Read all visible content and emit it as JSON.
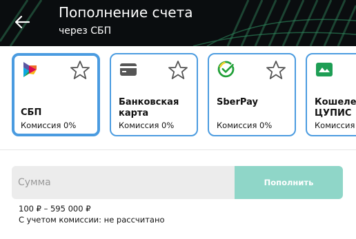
{
  "header": {
    "title": "Пополнение счета",
    "subtitle": "через СБП",
    "background_color": "#0a0d0f",
    "accent_color": "#2f8f62"
  },
  "methods": [
    {
      "name": "СБП",
      "fee": "Комиссия 0%",
      "icon": "sbp-logo-icon",
      "selected": true
    },
    {
      "name": "Банковская карта",
      "fee": "Комиссия 0%",
      "icon": "bank-card-icon",
      "selected": false
    },
    {
      "name": "SberPay",
      "fee": "Комиссия 0%",
      "icon": "sberpay-logo-icon",
      "selected": false
    },
    {
      "name": "Кошелек ЦУПИС",
      "fee": "Комиссия",
      "icon": "wallet-icon",
      "selected": false
    }
  ],
  "form": {
    "amount_placeholder": "Сумма",
    "amount_value": "",
    "submit_label": "Пополнить",
    "range": "100 ₽ – 595 000 ₽",
    "commission_note": "С учетом комиссии: не рассчитано"
  },
  "colors": {
    "card_border": "#4a9be0",
    "button_bg": "#8fd6c8",
    "input_bg": "#ececec"
  }
}
